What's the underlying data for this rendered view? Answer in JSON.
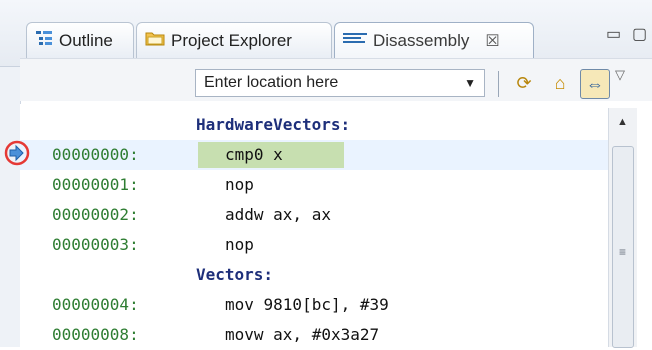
{
  "tabs": [
    {
      "label": "Outline",
      "icon": "outline-icon"
    },
    {
      "label": "Project Explorer",
      "icon": "folder-icon"
    },
    {
      "label": "Disassembly",
      "icon": "disassembly-icon",
      "close": "☒",
      "active": true
    }
  ],
  "toolbar": {
    "location_placeholder": "Enter location here"
  },
  "disassembly": {
    "lines": [
      {
        "type": "label",
        "text": "HardwareVectors:"
      },
      {
        "type": "instr",
        "addr": "00000000:",
        "text": "cmp0 x",
        "current": true
      },
      {
        "type": "instr",
        "addr": "00000001:",
        "text": "nop"
      },
      {
        "type": "instr",
        "addr": "00000002:",
        "text": "addw ax, ax"
      },
      {
        "type": "instr",
        "addr": "00000003:",
        "text": "nop"
      },
      {
        "type": "label",
        "text": "Vectors:"
      },
      {
        "type": "instr",
        "addr": "00000004:",
        "text": "mov 9810[bc], #39"
      },
      {
        "type": "instr",
        "addr": "00000008:",
        "text": "movw ax, #0x3a27"
      }
    ]
  },
  "colors": {
    "address": "#2e7d32",
    "label": "#1e2f7a",
    "current_line_bg": "#eaf3ff",
    "current_instr_bg": "#c7dfb0",
    "marker_ring": "#e53935"
  }
}
